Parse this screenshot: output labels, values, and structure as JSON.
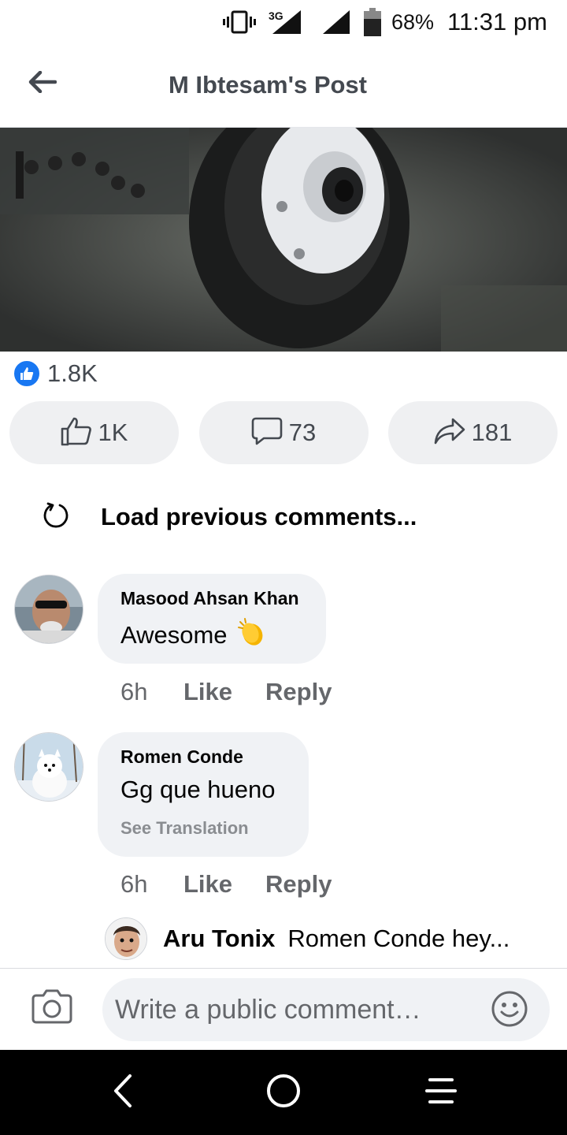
{
  "status_bar": {
    "network": "3G",
    "battery_percent": "68%",
    "battery_level": 0.68,
    "time": "11:31 pm"
  },
  "header": {
    "title": "M Ibtesam's Post",
    "back_icon": "arrow-left-icon"
  },
  "post": {
    "photo_icon": "post-photo",
    "reaction_icon": "like-reaction-icon",
    "reaction_count": "1.8K",
    "actions": [
      {
        "icon": "thumbs-up-icon",
        "label": "1K"
      },
      {
        "icon": "comment-icon",
        "label": "73"
      },
      {
        "icon": "share-icon",
        "label": "181"
      }
    ]
  },
  "comments_section": {
    "load_previous_label": "Load previous comments...",
    "load_previous_icon": "refresh-icon",
    "comments": [
      {
        "author": "Masood Ahsan Khan",
        "text": "Awesome",
        "emoji_icon": "clapping-hands-icon",
        "time": "6h",
        "like_label": "Like",
        "reply_label": "Reply"
      },
      {
        "author": "Romen Conde",
        "text": "Gg que hueno",
        "translation_label": "See Translation",
        "time": "6h",
        "like_label": "Like",
        "reply_label": "Reply",
        "reply_preview": {
          "author": "Aru Tonix",
          "text": "Romen Conde hey..."
        }
      }
    ]
  },
  "composer": {
    "placeholder": "Write a public comment…",
    "camera_icon": "camera-icon",
    "emoji_icon": "smiley-icon"
  },
  "nav_bar": {
    "back_icon": "nav-back-icon",
    "home_icon": "nav-home-icon",
    "menu_icon": "nav-menu-icon"
  },
  "colors": {
    "accent": "#1877f2",
    "pill_bg": "#eff0f2",
    "bubble_bg": "#f0f2f5",
    "secondary_text": "#65676b"
  }
}
